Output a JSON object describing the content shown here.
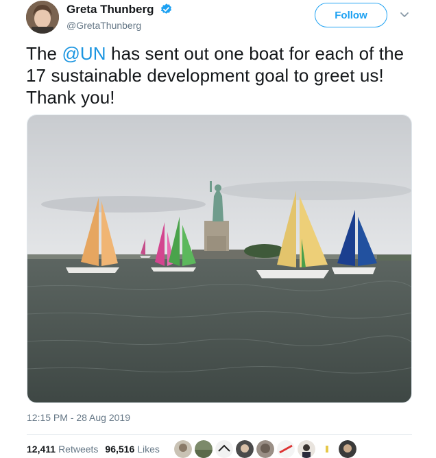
{
  "author": {
    "name": "Greta Thunberg",
    "handle": "@GretaThunberg"
  },
  "actions": {
    "follow_label": "Follow"
  },
  "tweet": {
    "text_before": "The ",
    "mention": "@UN",
    "text_after": " has sent out one boat for each of the 17 sustainable development goal to greet us! Thank you!"
  },
  "timestamp": "12:15 PM - 28 Aug 2019",
  "stats": {
    "retweets_count": "12,411",
    "retweets_label": "Retweets",
    "likes_count": "96,516",
    "likes_label": "Likes"
  },
  "icons": [
    "verified-badge-icon",
    "chevron-down-icon"
  ],
  "colors": {
    "brand_blue": "#1da1f2",
    "mention_blue": "#1b95e0",
    "muted_gray": "#657786"
  }
}
